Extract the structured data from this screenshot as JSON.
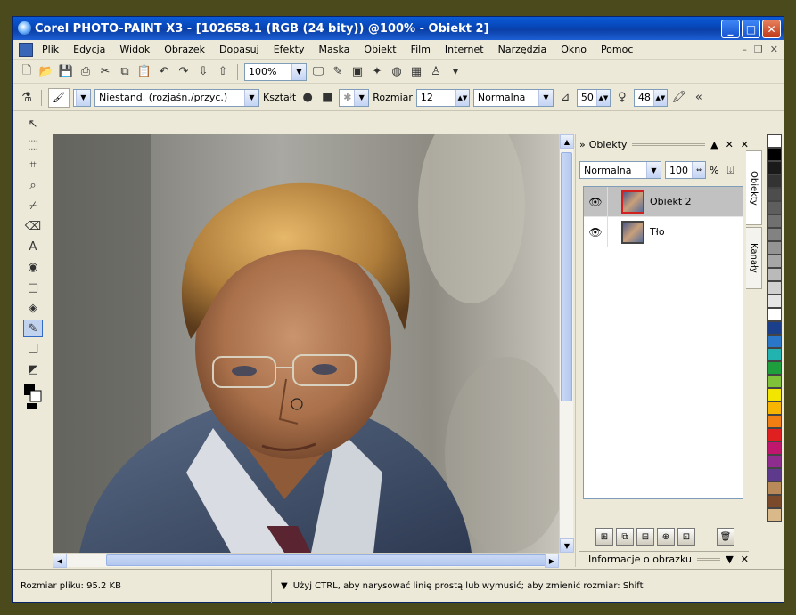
{
  "window": {
    "title": "Corel PHOTO-PAINT X3 - [102658.1 (RGB (24 bity)) @100% - Obiekt 2]"
  },
  "menu": [
    "Plik",
    "Edycja",
    "Widok",
    "Obrazek",
    "Dopasuj",
    "Efekty",
    "Maska",
    "Obiekt",
    "Film",
    "Internet",
    "Narzędzia",
    "Okno",
    "Pomoc"
  ],
  "toolbar": {
    "zoom": "100%"
  },
  "property_bar": {
    "brush_type": "Niestand. (rozjaśn./przyc.)",
    "shape_label": "Kształt",
    "size_label": "Rozmiar",
    "size_value": "12",
    "merge_mode": "Normalna",
    "transparency": "50",
    "soften": "48"
  },
  "docker": {
    "title": "Obiekty",
    "merge_mode": "Normalna",
    "opacity": "100",
    "opacity_unit": "%",
    "layers": [
      {
        "name": "Obiekt 2",
        "selected": true
      },
      {
        "name": "Tło",
        "selected": false
      }
    ],
    "footer_title": "Informacje o obrazku"
  },
  "side_tabs": [
    "Obiekty",
    "Kanały"
  ],
  "status": {
    "file_size": "Rozmiar pliku: 95.2 KB",
    "hint": "Użyj CTRL, aby narysować linię prostą lub wymusić; aby zmienić rozmiar: Shift"
  },
  "palette": [
    "#ffffff",
    "#000000",
    "#1a1a1a",
    "#333333",
    "#4d4d4d",
    "#5e5e5e",
    "#707070",
    "#828282",
    "#949494",
    "#a6a6a6",
    "#bababa",
    "#d0d0d0",
    "#e5e5e5",
    "#ffffff",
    "#1b3f8b",
    "#2a77c9",
    "#22b3b0",
    "#1f9e3d",
    "#7fc23a",
    "#f2e500",
    "#f7b500",
    "#f07e12",
    "#e02020",
    "#c0176e",
    "#8e2d8e",
    "#5e3a8c",
    "#b88a5a",
    "#7a4a2a",
    "#d9b98a"
  ]
}
